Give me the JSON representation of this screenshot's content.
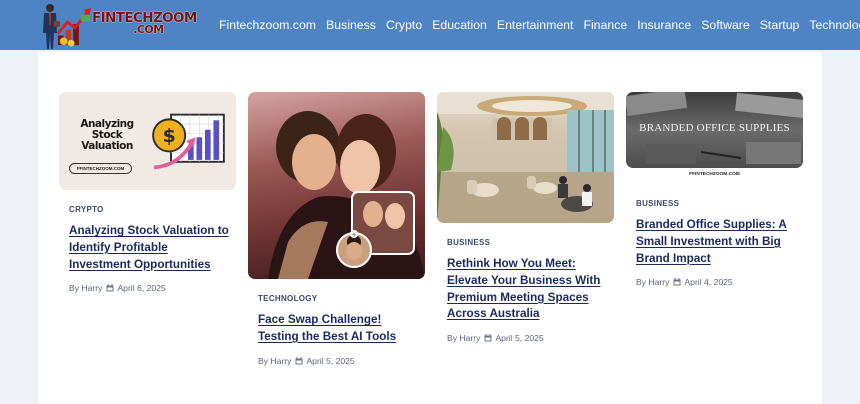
{
  "site": {
    "logo_line1": "FINTECHZOOM",
    "logo_line2": ".COM"
  },
  "nav": {
    "items": [
      "Fintechzoom.com",
      "Business",
      "Crypto",
      "Education",
      "Entertainment",
      "Finance",
      "Insurance",
      "Software",
      "Startup",
      "Technology"
    ]
  },
  "colors": {
    "header": "#4f84c4",
    "background": "#eef1f5",
    "panel": "#ffffff",
    "title": "#1a2b5a",
    "logo": "#7a1212"
  },
  "posts": [
    {
      "category": "CRYPTO",
      "title": "Analyzing Stock Valuation to Identify Profitable Investment Opportunities",
      "author": "By Harry",
      "date": "April 6, 2025",
      "thumb_heading": "Analyzing Stock Valuation",
      "thumb_pill": "FFINTECHZOOM.COM"
    },
    {
      "category": "TECHNOLOGY",
      "title": "Face Swap Challenge! Testing the Best AI Tools",
      "author": "By Harry",
      "date": "April 5, 2025"
    },
    {
      "category": "BUSINESS",
      "title": "Rethink How You Meet: Elevate Your Business With Premium Meeting Spaces Across Australia",
      "author": "By Harry",
      "date": "April 5, 2025"
    },
    {
      "category": "BUSINESS",
      "title": "Branded Office Supplies: A Small Investment with Big Brand Impact",
      "author": "By Harry",
      "date": "April 4, 2025",
      "thumb_heading": "BRANDED OFFICE SUPPLIES",
      "thumb_caption": "FFINTECHZOOM.COM"
    }
  ]
}
